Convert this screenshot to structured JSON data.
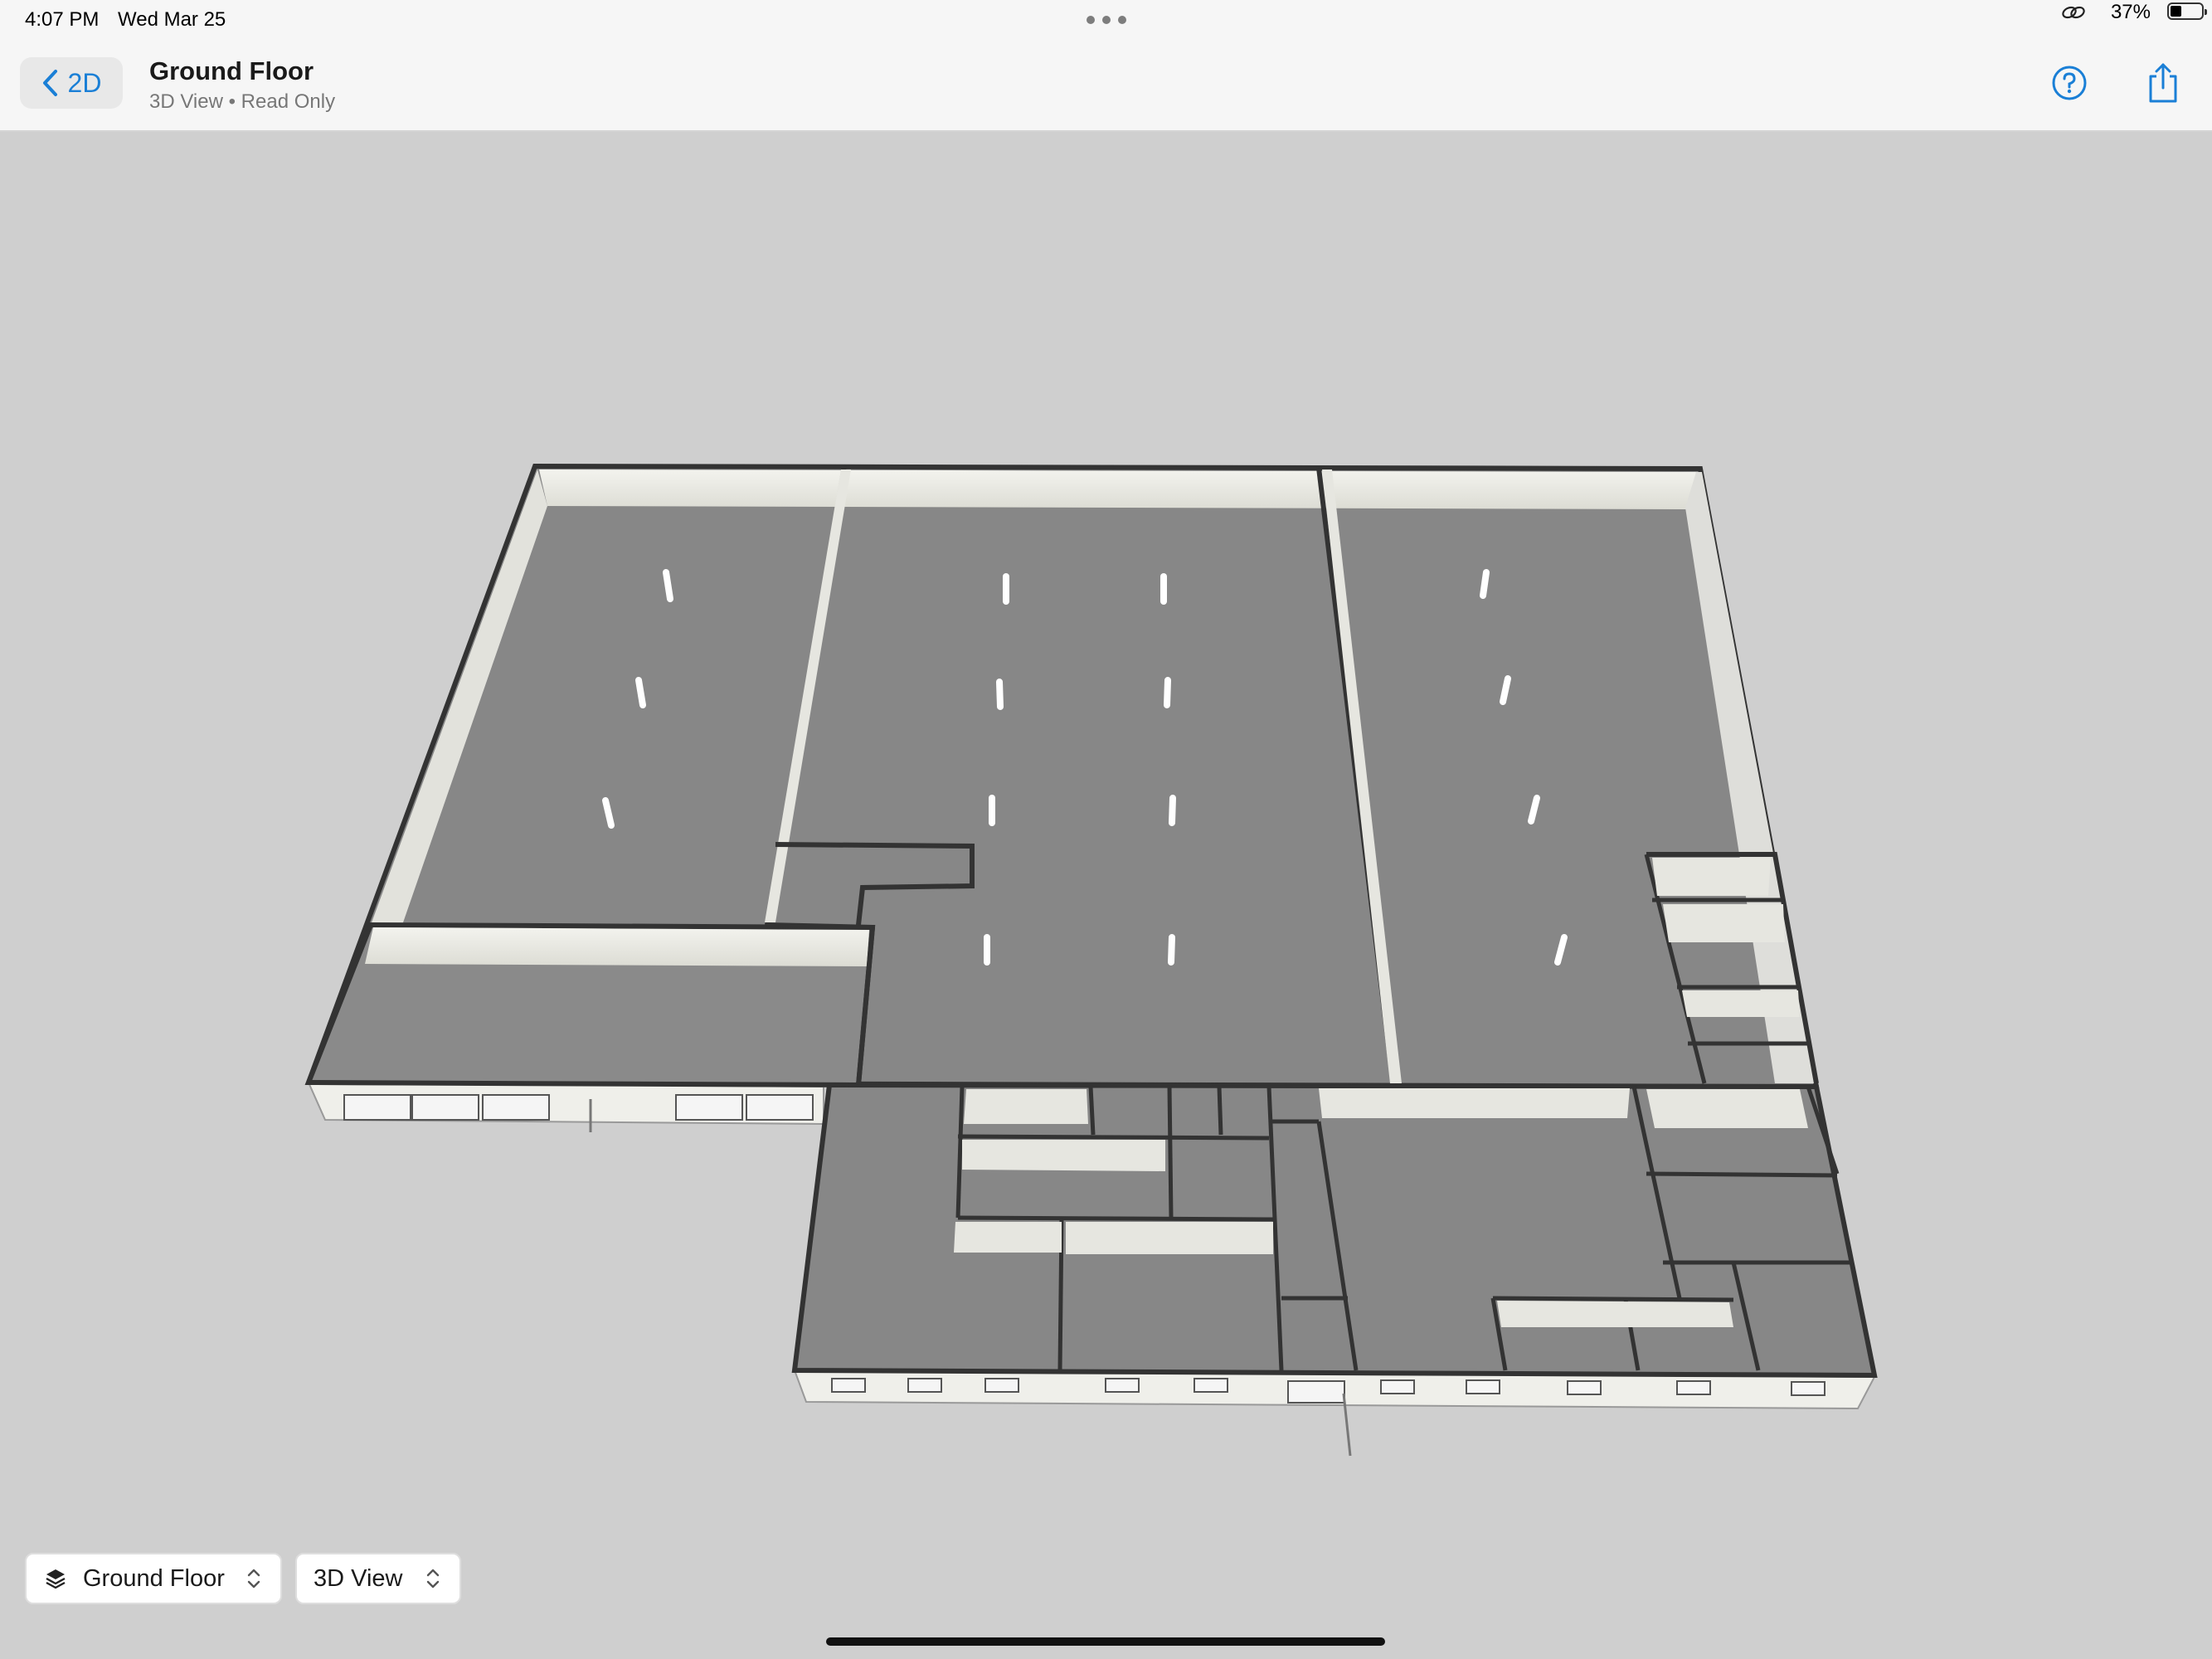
{
  "status_bar": {
    "time": "4:07 PM",
    "date": "Wed Mar 25",
    "battery": "37%",
    "battery_level": 0.37,
    "icons": [
      "multitasking-dots-icon",
      "link-icon",
      "battery-icon"
    ]
  },
  "nav": {
    "back_label": "2D",
    "title": "Ground Floor",
    "subtitle": "3D View • Read Only",
    "icons": [
      "chevron-left-icon",
      "help-icon",
      "share-icon"
    ]
  },
  "controls": {
    "floor_select": {
      "value": "Ground Floor",
      "icon": "layers-icon"
    },
    "view_select": {
      "value": "3D View"
    }
  },
  "colors": {
    "accent": "#1a7fd6",
    "canvas": "#cfcfcf",
    "floor": "#858585",
    "wall_top": "#3a3a3a",
    "wall_face": "#eeeee8",
    "bar": "#f6f6f6"
  }
}
